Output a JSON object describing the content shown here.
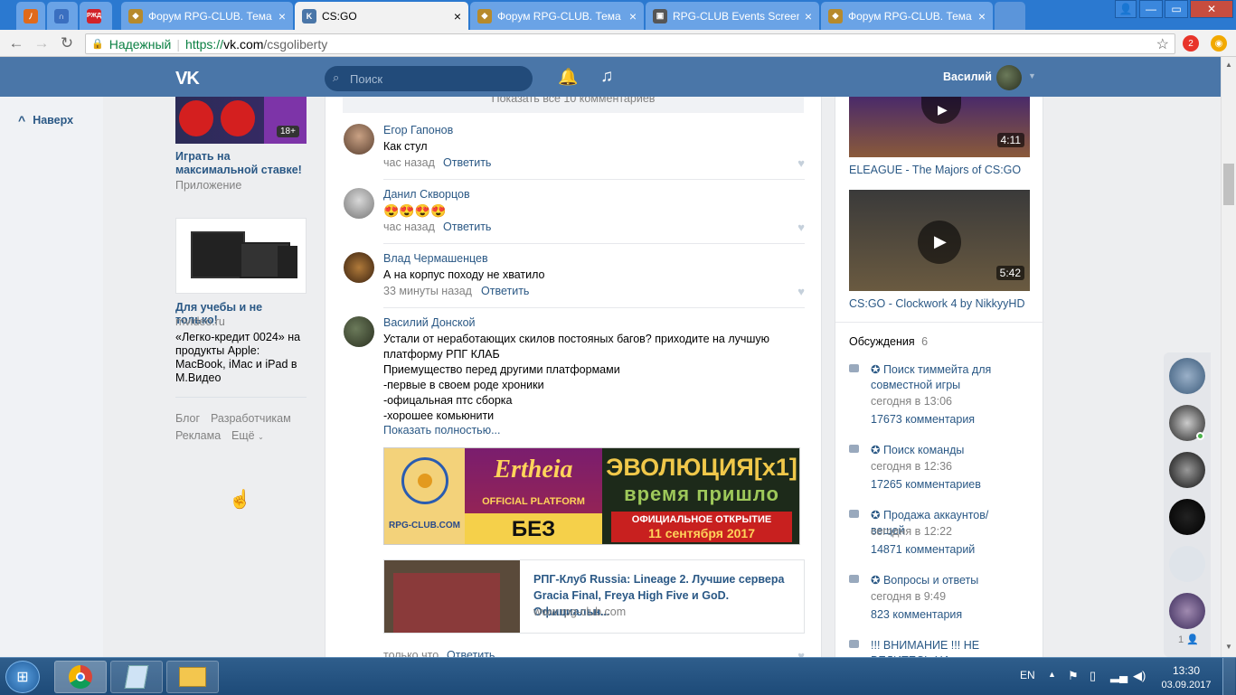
{
  "browser": {
    "tabs": [
      {
        "title": "",
        "icon": "fire-icon",
        "color": "#e06a1b"
      },
      {
        "title": "",
        "icon": "loop-icon",
        "color": "#3a6fc0"
      },
      {
        "title": "",
        "icon": "rzd-icon",
        "color": "#d2232a"
      },
      {
        "title": "Форум RPG-CLUB. Тема",
        "icon": "shield-icon",
        "color": "#b68a2c"
      },
      {
        "title": "CS:GO",
        "icon": "vk-icon",
        "color": "#4a76a8"
      },
      {
        "title": "Форум RPG-CLUB. Тема",
        "icon": "shield-icon",
        "color": "#b68a2c"
      },
      {
        "title": "RPG-CLUB Events Screen",
        "icon": "image-icon",
        "color": "#555555"
      },
      {
        "title": "Форум RPG-CLUB. Тема",
        "icon": "shield-icon",
        "color": "#b68a2c"
      }
    ],
    "secure_label": "Надежный",
    "url_prefix": "https://",
    "url_host": "vk.com",
    "url_path": "/csgoliberty",
    "ext_badge": "2"
  },
  "vk": {
    "search_placeholder": "Поиск",
    "user_name": "Василий",
    "back_to_top": "Наверх"
  },
  "left_ads": [
    {
      "title": "Играть на максимальной ставке!",
      "sub": "Приложение",
      "badge": "18+"
    },
    {
      "title": "Для учебы и не только!",
      "sub": "mvideo.ru",
      "desc": "«Легко-кредит 0024» на продукты Apple: MacBook, iMac и iPad в М.Видео"
    }
  ],
  "left_footer": {
    "blog": "Блог",
    "dev": "Разработчикам",
    "ads": "Реклама",
    "more": "Ещё"
  },
  "feed": {
    "show_all": "Показать все 10 комментариев",
    "comments": [
      {
        "name": "Егор Гапонов",
        "text": "Как стул",
        "time": "час назад",
        "reply": "Ответить"
      },
      {
        "name": "Данил Скворцов",
        "text": "😍😍😍😍",
        "time": "час назад",
        "reply": "Ответить"
      },
      {
        "name": "Влад Чермашенцев",
        "text": "А на корпус походу не хватило",
        "time": "33 минуты назад",
        "reply": "Ответить"
      },
      {
        "name": "Василий Донской",
        "lines": [
          "Устали от неработающих скилов постояных багов? приходите на лучшую",
          "платформу РПГ КЛАБ",
          "Приемущество перед другими платформами",
          "-первые в своем роде хроники",
          "-офицальная птс сборка",
          "-хорошее комьюнити"
        ],
        "more": "Показать полностью...",
        "time": "только что",
        "reply": "Ответить"
      }
    ],
    "banner": {
      "left": "RPG-CLUB.COM",
      "mid_top": "Ertheia",
      "mid_sub": "OFFICIAL PLATFORM",
      "mid_bottom": "БЕЗ ДОНАТА",
      "right_top": "ЭВОЛЮЦИЯ[x1]",
      "right_mid": "время пришло",
      "right_bottom1": "ОФИЦИАЛЬНОЕ ОТКРЫТИЕ",
      "right_bottom2": "11 сентября 2017"
    },
    "link": {
      "title": "РПГ-Клуб Russia: Lineage 2. Лучшие сервера Gracia Final, Freya High Five и GoD. Официальн...",
      "domain": "www.rpg-club.com"
    }
  },
  "right": {
    "videos": [
      {
        "title": "ELEAGUE - The Majors of CS:GO",
        "duration": "4:11"
      },
      {
        "title": "CS:GO - Clockwork 4 by NikkyyHD",
        "duration": "5:42"
      }
    ],
    "discussions_label": "Обсуждения",
    "discussions_count": "6",
    "discussions": [
      {
        "title": "✪ Поиск тиммейта для совместной игры",
        "date": "сегодня в 13:06",
        "count": "17673 комментария"
      },
      {
        "title": "✪ Поиск команды",
        "date": "сегодня в 12:36",
        "count": "17265 комментариев"
      },
      {
        "title": "✪ Продажа аккаунтов/вещей",
        "date": "сегодня в 12:22",
        "count": "14871 комментарий"
      },
      {
        "title": "✪ Вопросы и ответы",
        "date": "сегодня в 9:49",
        "count": "823 комментария"
      },
      {
        "title": "!!! ВНИМАНИЕ !!! НЕ ВЕДИТЕСЬ НА СООБЩЕНИЯ"
      }
    ],
    "friends_count": "1"
  },
  "taskbar": {
    "lang": "EN",
    "time": "13:30",
    "date": "03.09.2017"
  }
}
